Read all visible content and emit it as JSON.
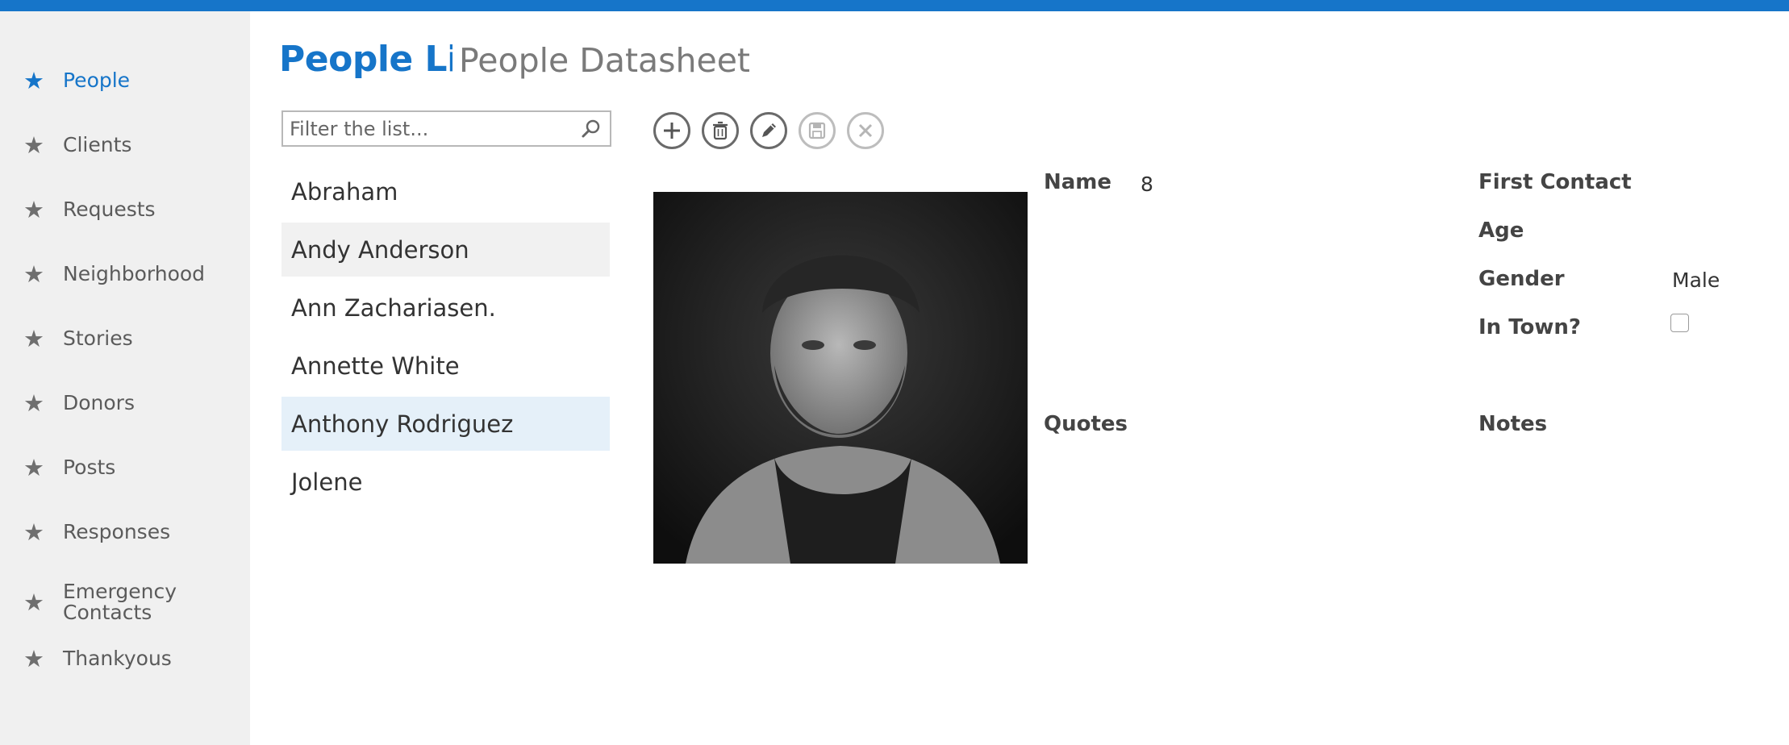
{
  "colors": {
    "accent": "#1675c9",
    "sidebar_bg": "#f0f0f0",
    "selected_row": "#e5f0f9",
    "hover_row": "#f1f1f1"
  },
  "sidebar": {
    "items": [
      {
        "label": "People",
        "icon": "star-icon",
        "active": true
      },
      {
        "label": "Clients",
        "icon": "star-icon"
      },
      {
        "label": "Requests",
        "icon": "star-icon"
      },
      {
        "label": "Neighborhood",
        "icon": "star-icon"
      },
      {
        "label": "Stories",
        "icon": "star-icon"
      },
      {
        "label": "Donors",
        "icon": "star-icon"
      },
      {
        "label": "Posts",
        "icon": "star-icon"
      },
      {
        "label": "Responses",
        "icon": "star-icon"
      },
      {
        "label": "Emergency Contacts",
        "icon": "star-icon"
      },
      {
        "label": "Thankyous",
        "icon": "star-icon"
      }
    ]
  },
  "header": {
    "app_name": "People Lis",
    "view_name": "People Datasheet"
  },
  "filter": {
    "placeholder": "Filter the list...",
    "value": "",
    "icon": "search-icon"
  },
  "list": {
    "items": [
      {
        "name": "Abraham"
      },
      {
        "name": "Andy Anderson",
        "state": "hover"
      },
      {
        "name": "Ann Zachariasen."
      },
      {
        "name": "Annette White"
      },
      {
        "name": "Anthony Rodriguez",
        "state": "selected"
      },
      {
        "name": "Jolene"
      }
    ]
  },
  "toolbar": {
    "buttons": [
      {
        "icon": "add-icon",
        "enabled": true
      },
      {
        "icon": "delete-icon",
        "enabled": true
      },
      {
        "icon": "edit-icon",
        "enabled": true
      },
      {
        "icon": "save-icon",
        "enabled": false
      },
      {
        "icon": "cancel-icon",
        "enabled": false
      }
    ]
  },
  "record": {
    "photo": "portrait-photo",
    "name_label": "Name",
    "name_value": "8",
    "first_contact_label": "First Contact",
    "first_contact_value": "",
    "age_label": "Age",
    "age_value": "",
    "gender_label": "Gender",
    "gender_value": "Male",
    "in_town_label": "In Town?",
    "in_town_checked": false,
    "quotes_label": "Quotes",
    "notes_label": "Notes"
  }
}
